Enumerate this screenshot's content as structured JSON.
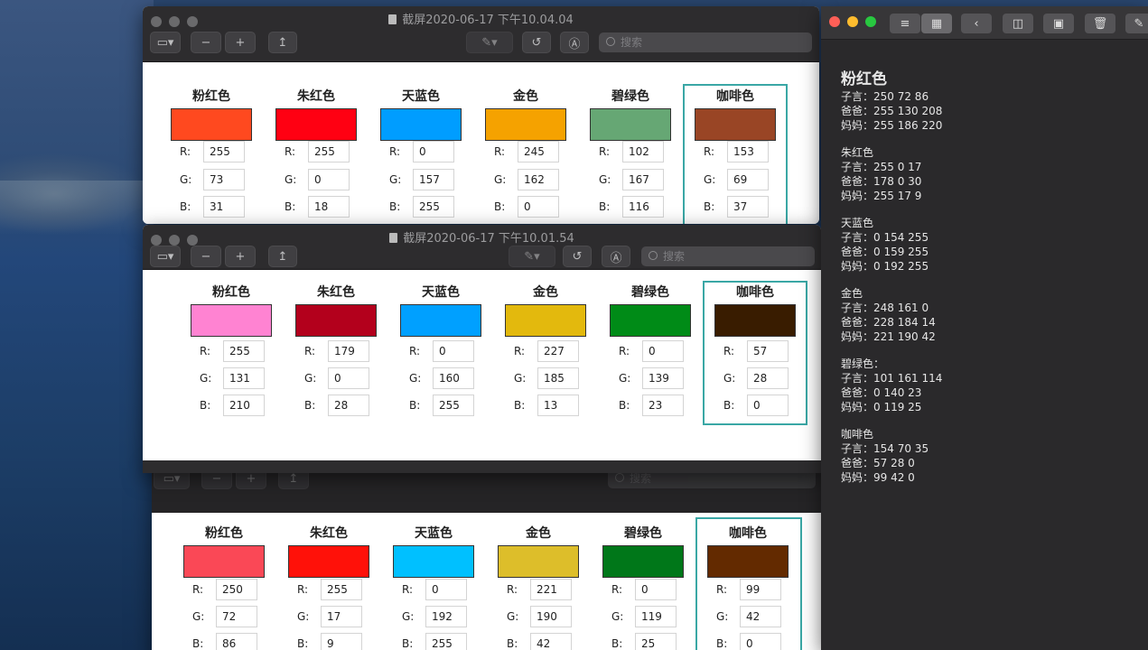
{
  "windows": {
    "top_title": "截屏2020-06-17 下午10.04.04",
    "middle_title": "截屏2020-06-17 下午10.01.54",
    "search_placeholder": "搜索"
  },
  "panels": {
    "top": {
      "swatches": [
        {
          "name": "粉红色",
          "color": "#ff491f",
          "r": "255",
          "g": "73",
          "b": "31"
        },
        {
          "name": "朱红色",
          "color": "#ff0012",
          "r": "255",
          "g": "0",
          "b": "18"
        },
        {
          "name": "天蓝色",
          "color": "#009dff",
          "r": "0",
          "g": "157",
          "b": "255"
        },
        {
          "name": "金色",
          "color": "#f5a200",
          "r": "245",
          "g": "162",
          "b": "0"
        },
        {
          "name": "碧绿色",
          "color": "#66a774",
          "r": "102",
          "g": "167",
          "b": "116"
        },
        {
          "name": "咖啡色",
          "color": "#994525",
          "r": "153",
          "g": "69",
          "b": "37"
        }
      ]
    },
    "middle": {
      "swatches": [
        {
          "name": "粉红色",
          "color": "#ff83d2",
          "r": "255",
          "g": "131",
          "b": "210"
        },
        {
          "name": "朱红色",
          "color": "#b3001c",
          "r": "179",
          "g": "0",
          "b": "28"
        },
        {
          "name": "天蓝色",
          "color": "#00a0ff",
          "r": "0",
          "g": "160",
          "b": "255"
        },
        {
          "name": "金色",
          "color": "#e3b90d",
          "r": "227",
          "g": "185",
          "b": "13"
        },
        {
          "name": "碧绿色",
          "color": "#008b17",
          "r": "0",
          "g": "139",
          "b": "23"
        },
        {
          "name": "咖啡色",
          "color": "#391c00",
          "r": "57",
          "g": "28",
          "b": "0"
        }
      ]
    },
    "bottom": {
      "swatches": [
        {
          "name": "粉红色",
          "color": "#fa4856",
          "r": "250",
          "g": "72",
          "b": "86"
        },
        {
          "name": "朱红色",
          "color": "#ff1109",
          "r": "255",
          "g": "17",
          "b": "9"
        },
        {
          "name": "天蓝色",
          "color": "#00c0ff",
          "r": "0",
          "g": "192",
          "b": "255"
        },
        {
          "name": "金色",
          "color": "#ddbe2a",
          "r": "221",
          "g": "190",
          "b": "42"
        },
        {
          "name": "碧绿色",
          "color": "#007719",
          "r": "0",
          "g": "119",
          "b": "25"
        },
        {
          "name": "咖啡色",
          "color": "#632a00",
          "r": "99",
          "g": "42",
          "b": "0"
        }
      ]
    }
  },
  "labels": {
    "r": "R:",
    "g": "G:",
    "b": "B:"
  },
  "notes": {
    "title": "粉红色",
    "sections": [
      {
        "heading": "",
        "lines": [
          "子言：250 72 86",
          "爸爸：255 130 208",
          "妈妈：255 186 220"
        ]
      },
      {
        "heading": "朱红色",
        "lines": [
          "子言：255 0 17",
          "爸爸：178 0 30",
          "妈妈：255 17 9"
        ]
      },
      {
        "heading": "天蓝色",
        "lines": [
          "子言：0 154 255",
          "爸爸：0 159 255",
          "妈妈：0 192 255"
        ]
      },
      {
        "heading": "金色",
        "lines": [
          "子言：248 161 0",
          "爸爸：228 184 14",
          "妈妈：221 190 42"
        ]
      },
      {
        "heading": "碧绿色：",
        "lines": [
          "子言：101 161 114",
          "爸爸：0 140 23",
          "妈妈：0 119 25"
        ]
      },
      {
        "heading": "咖啡色",
        "lines": [
          "子言：154 70 35",
          "爸爸：57 28 0",
          "妈妈：99 42 0"
        ]
      }
    ]
  }
}
